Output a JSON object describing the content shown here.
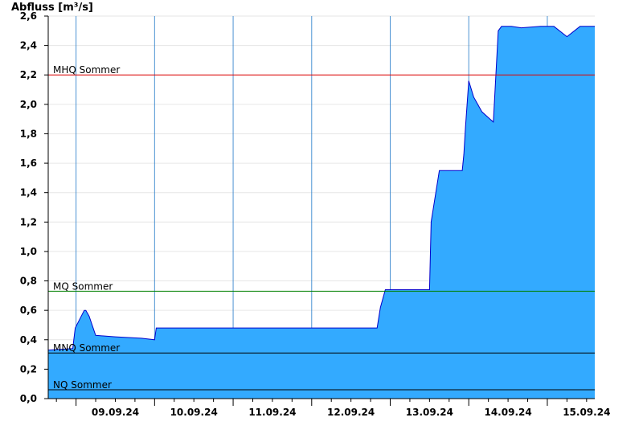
{
  "chart_data": {
    "type": "area",
    "ylabel": "Abfluss [m³/s]",
    "ylim": [
      0,
      2.6
    ],
    "yticks": [
      {
        "v": 0.0,
        "label": "0,0"
      },
      {
        "v": 0.2,
        "label": "0,2"
      },
      {
        "v": 0.4,
        "label": "0,4"
      },
      {
        "v": 0.6,
        "label": "0,6"
      },
      {
        "v": 0.8,
        "label": "0,8"
      },
      {
        "v": 1.0,
        "label": "1,0"
      },
      {
        "v": 1.2,
        "label": "1,2"
      },
      {
        "v": 1.4,
        "label": "1,4"
      },
      {
        "v": 1.6,
        "label": "1,6"
      },
      {
        "v": 1.8,
        "label": "1,8"
      },
      {
        "v": 2.0,
        "label": "2,0"
      },
      {
        "v": 2.2,
        "label": "2,2"
      },
      {
        "v": 2.4,
        "label": "2,4"
      },
      {
        "v": 2.6,
        "label": "2,6"
      }
    ],
    "xrange": [
      "08.09.24 15:30",
      "15.09.24 14:30"
    ],
    "xtick_labels": [
      "09.09.24",
      "10.09.24",
      "11.09.24",
      "12.09.24",
      "13.09.24",
      "14.09.24",
      "15.09.24"
    ],
    "grid": true,
    "fill_color": "#33aaff",
    "line_color": "#0000cc",
    "reference_lines": [
      {
        "name": "MHQ Sommer",
        "value": 2.2,
        "color": "#e00000"
      },
      {
        "name": "MQ Sommer",
        "value": 0.73,
        "color": "#008000"
      },
      {
        "name": "MNQ Sommer",
        "value": 0.31,
        "color": "#000000"
      },
      {
        "name": "NQ Sommer",
        "value": 0.06,
        "color": "#000000"
      }
    ],
    "series": [
      {
        "x": [
          "08.09.24 15:30",
          "08.09.24 23:00",
          "08.09.24 23:45",
          "09.09.24 02:30",
          "09.09.24 03:00",
          "09.09.24 04:00",
          "09.09.24 06:00",
          "09.09.24 12:00",
          "09.09.24 20:00",
          "10.09.24 00:00",
          "10.09.24 00:30",
          "10.09.24 08:00",
          "10.09.24 14:00",
          "11.09.24 08:00",
          "11.09.24 12:00",
          "11.09.24 18:00",
          "11.09.24 23:00",
          "12.09.24 08:00",
          "12.09.24 12:00",
          "12.09.24 20:00",
          "12.09.24 21:00",
          "12.09.24 22:30",
          "13.09.24 05:00",
          "13.09.24 12:00",
          "13.09.24 12:30",
          "13.09.24 15:00",
          "13.09.24 21:30",
          "13.09.24 22:00",
          "13.09.24 22:30",
          "13.09.24 23:00",
          "14.09.24 00:00",
          "14.09.24 01:30",
          "14.09.24 04:00",
          "14.09.24 06:30",
          "14.09.24 07:30",
          "14.09.24 09:00",
          "14.09.24 10:00",
          "14.09.24 10:30",
          "14.09.24 11:00",
          "14.09.24 12:00",
          "14.09.24 12:30",
          "14.09.24 13:00",
          "14.09.24 16:00",
          "14.09.24 22:00",
          "15.09.24 02:00",
          "15.09.24 06:00",
          "15.09.24 10:00",
          "15.09.24 13:00",
          "15.09.24 14:30"
        ],
        "y": [
          0.33,
          0.34,
          0.48,
          0.6,
          0.6,
          0.56,
          0.43,
          0.42,
          0.41,
          0.4,
          0.48,
          0.48,
          0.48,
          0.48,
          0.48,
          0.48,
          0.48,
          0.48,
          0.48,
          0.48,
          0.62,
          0.74,
          0.74,
          0.74,
          1.2,
          1.55,
          1.55,
          1.55,
          1.66,
          1.85,
          2.16,
          2.05,
          1.95,
          1.9,
          1.88,
          2.5,
          2.53,
          2.53,
          2.53,
          2.53,
          2.53,
          2.53,
          2.52,
          2.53,
          2.53,
          2.46,
          2.53,
          2.53,
          2.53
        ]
      }
    ]
  }
}
